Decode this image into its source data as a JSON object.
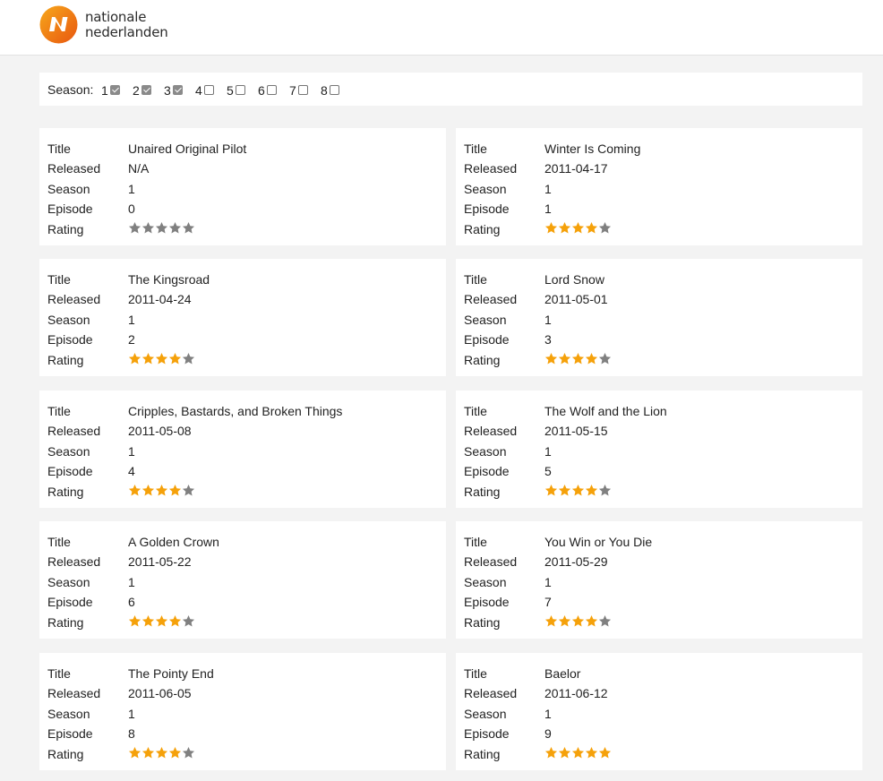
{
  "brand": {
    "line1": "nationale",
    "line2": "nederlanden",
    "colors": {
      "orange": "#f28c00",
      "orange_dark": "#e35a10"
    }
  },
  "filter": {
    "label": "Season:",
    "seasons": [
      {
        "label": "1",
        "checked": true
      },
      {
        "label": "2",
        "checked": true
      },
      {
        "label": "3",
        "checked": true
      },
      {
        "label": "4",
        "checked": false
      },
      {
        "label": "5",
        "checked": false
      },
      {
        "label": "6",
        "checked": false
      },
      {
        "label": "7",
        "checked": false
      },
      {
        "label": "8",
        "checked": false
      }
    ]
  },
  "field_labels": {
    "title": "Title",
    "released": "Released",
    "season": "Season",
    "episode": "Episode",
    "rating": "Rating"
  },
  "star_colors": {
    "filled": "#f5a10a",
    "empty": "#808080"
  },
  "episodes": [
    {
      "title": "Unaired Original Pilot",
      "released": "N/A",
      "season": "1",
      "episode": "0",
      "rating": 0
    },
    {
      "title": "Winter Is Coming",
      "released": "2011-04-17",
      "season": "1",
      "episode": "1",
      "rating": 4
    },
    {
      "title": "The Kingsroad",
      "released": "2011-04-24",
      "season": "1",
      "episode": "2",
      "rating": 4
    },
    {
      "title": "Lord Snow",
      "released": "2011-05-01",
      "season": "1",
      "episode": "3",
      "rating": 4
    },
    {
      "title": "Cripples, Bastards, and Broken Things",
      "released": "2011-05-08",
      "season": "1",
      "episode": "4",
      "rating": 4
    },
    {
      "title": "The Wolf and the Lion",
      "released": "2011-05-15",
      "season": "1",
      "episode": "5",
      "rating": 4
    },
    {
      "title": "A Golden Crown",
      "released": "2011-05-22",
      "season": "1",
      "episode": "6",
      "rating": 4
    },
    {
      "title": "You Win or You Die",
      "released": "2011-05-29",
      "season": "1",
      "episode": "7",
      "rating": 4
    },
    {
      "title": "The Pointy End",
      "released": "2011-06-05",
      "season": "1",
      "episode": "8",
      "rating": 4
    },
    {
      "title": "Baelor",
      "released": "2011-06-12",
      "season": "1",
      "episode": "9",
      "rating": 5
    }
  ]
}
